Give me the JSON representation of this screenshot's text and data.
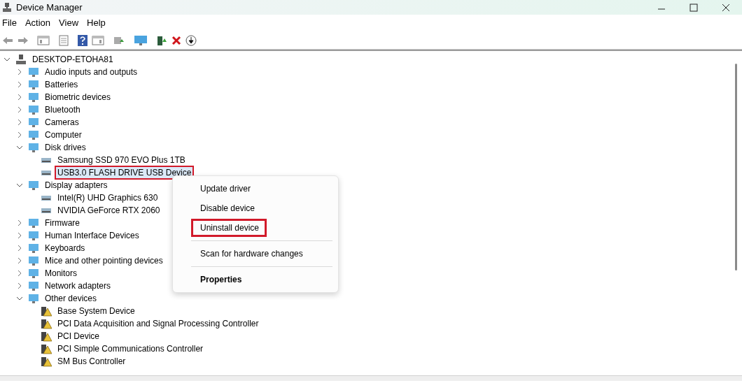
{
  "window": {
    "title": "Device Manager"
  },
  "menu": [
    "File",
    "Action",
    "View",
    "Help"
  ],
  "tree": {
    "label": "DESKTOP-ETOHA81",
    "expanded": true,
    "selected": false,
    "children": [
      {
        "label": "Audio inputs and outputs",
        "expanded": false,
        "selected": false
      },
      {
        "label": "Batteries",
        "expanded": false,
        "selected": false
      },
      {
        "label": "Biometric devices",
        "expanded": false,
        "selected": false
      },
      {
        "label": "Bluetooth",
        "expanded": false,
        "selected": false
      },
      {
        "label": "Cameras",
        "expanded": false,
        "selected": false
      },
      {
        "label": "Computer",
        "expanded": false,
        "selected": false
      },
      {
        "label": "Disk drives",
        "expanded": true,
        "selected": false,
        "children": [
          {
            "label": "Samsung SSD 970 EVO Plus 1TB",
            "selected": false,
            "highlighted": false,
            "problem": false
          },
          {
            "label": "USB3.0 FLASH DRIVE USB Device",
            "selected": true,
            "highlighted": true,
            "problem": false
          }
        ]
      },
      {
        "label": "Display adapters",
        "expanded": true,
        "selected": false,
        "children": [
          {
            "label": "Intel(R) UHD Graphics 630",
            "selected": false,
            "highlighted": false,
            "problem": false
          },
          {
            "label": "NVIDIA GeForce RTX 2060",
            "selected": false,
            "highlighted": false,
            "problem": false
          }
        ]
      },
      {
        "label": "Firmware",
        "expanded": false,
        "selected": false
      },
      {
        "label": "Human Interface Devices",
        "expanded": false,
        "selected": false
      },
      {
        "label": "Keyboards",
        "expanded": false,
        "selected": false
      },
      {
        "label": "Mice and other pointing devices",
        "expanded": false,
        "selected": false
      },
      {
        "label": "Monitors",
        "expanded": false,
        "selected": false
      },
      {
        "label": "Network adapters",
        "expanded": false,
        "selected": false
      },
      {
        "label": "Other devices",
        "expanded": true,
        "selected": false,
        "children": [
          {
            "label": "Base System Device",
            "selected": false,
            "highlighted": false,
            "problem": true
          },
          {
            "label": "PCI Data Acquisition and Signal Processing Controller",
            "selected": false,
            "highlighted": false,
            "problem": true
          },
          {
            "label": "PCI Device",
            "selected": false,
            "highlighted": false,
            "problem": true
          },
          {
            "label": "PCI Simple Communications Controller",
            "selected": false,
            "highlighted": false,
            "problem": true
          },
          {
            "label": "SM Bus Controller",
            "selected": false,
            "highlighted": false,
            "problem": true
          }
        ]
      }
    ]
  },
  "context_menu": [
    [
      {
        "label": "Update driver",
        "highlighted": false,
        "default": false
      },
      {
        "label": "Disable device",
        "highlighted": false,
        "default": false
      },
      {
        "label": "Uninstall device",
        "highlighted": true,
        "default": false
      }
    ],
    [
      {
        "label": "Scan for hardware changes",
        "highlighted": false,
        "default": false
      }
    ],
    [
      {
        "label": "Properties",
        "highlighted": false,
        "default": true
      }
    ]
  ]
}
